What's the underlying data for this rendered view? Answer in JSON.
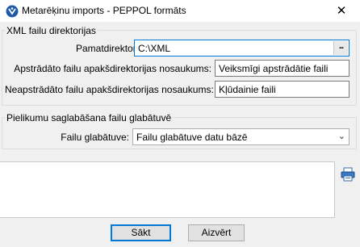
{
  "window": {
    "title": "Metarēķinu imports - PEPPOL formāts",
    "icon": "app-logo-icon",
    "close_glyph": "✕"
  },
  "xml_group": {
    "title": "XML failu direktorijas",
    "base_dir_label": "Pamatdirektorija:",
    "base_dir_value": "C:\\XML",
    "browse_glyph": "...",
    "processed_label": "Apstrādāto failu apakšdirektorijas nosaukums:",
    "processed_value": "Veiksmīgi apstrādātie faili",
    "unprocessed_label": "Neapstrādāto failu apakšdirektorijas nosaukums:",
    "unprocessed_value": "Kļūdainie faili"
  },
  "attachments_group": {
    "title": "Pielikumu saglabāšana failu glabātuvē",
    "storage_label": "Failu glabātuve:",
    "storage_value": "Failu glabātuve datu bāzē"
  },
  "log": {
    "print_icon": "printer-icon"
  },
  "buttons": {
    "start": "Sākt",
    "close": "Aizvērt"
  }
}
